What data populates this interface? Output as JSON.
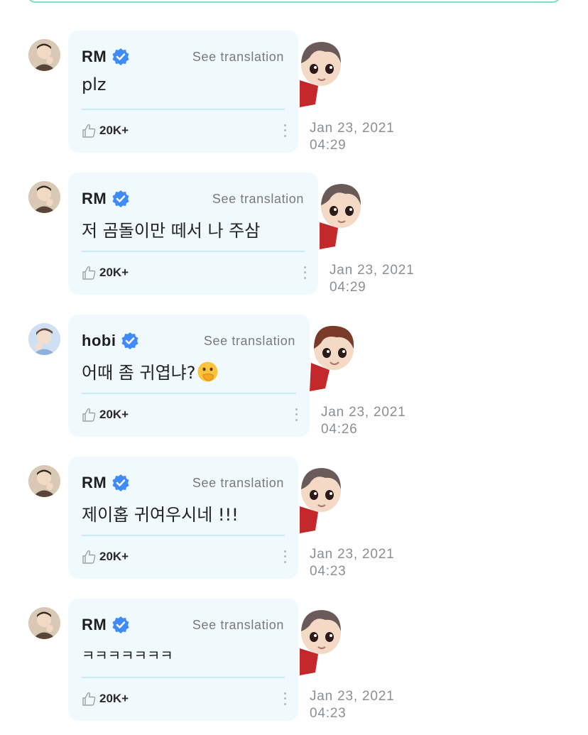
{
  "comments": [
    {
      "author": "RM",
      "translate_label": "See translation",
      "text": "plz",
      "likes": "20K+",
      "date": "Jan 23, 2021",
      "time": "04:29"
    },
    {
      "author": "RM",
      "translate_label": "See translation",
      "text": "저 곰돌이만 떼서 나 주삼",
      "likes": "20K+",
      "date": "Jan 23, 2021",
      "time": "04:29"
    },
    {
      "author": "hobi",
      "translate_label": "See translation",
      "text": "어때 좀 귀엽냐?",
      "likes": "20K+",
      "date": "Jan 23, 2021",
      "time": "04:26"
    },
    {
      "author": "RM",
      "translate_label": "See translation",
      "text": "제이홉 귀여우시네 !!!",
      "likes": "20K+",
      "date": "Jan 23, 2021",
      "time": "04:23"
    },
    {
      "author": "RM",
      "translate_label": "See translation",
      "text": "ㅋㅋㅋㅋㅋㅋㅋ",
      "likes": "20K+",
      "date": "Jan 23, 2021",
      "time": "04:23"
    }
  ],
  "icons": {
    "verified": "verified-badge-icon",
    "like": "thumbs-up-icon",
    "more": "more-vertical-icon",
    "emoji": "face-with-hand-over-mouth-emoji"
  },
  "colors": {
    "bubble_bg": "#f0f9fe",
    "divider": "#c8ecf1",
    "verified_blue": "#3d8bfd",
    "input_border": "#7fdcca",
    "timestamp": "#8a8f94"
  }
}
